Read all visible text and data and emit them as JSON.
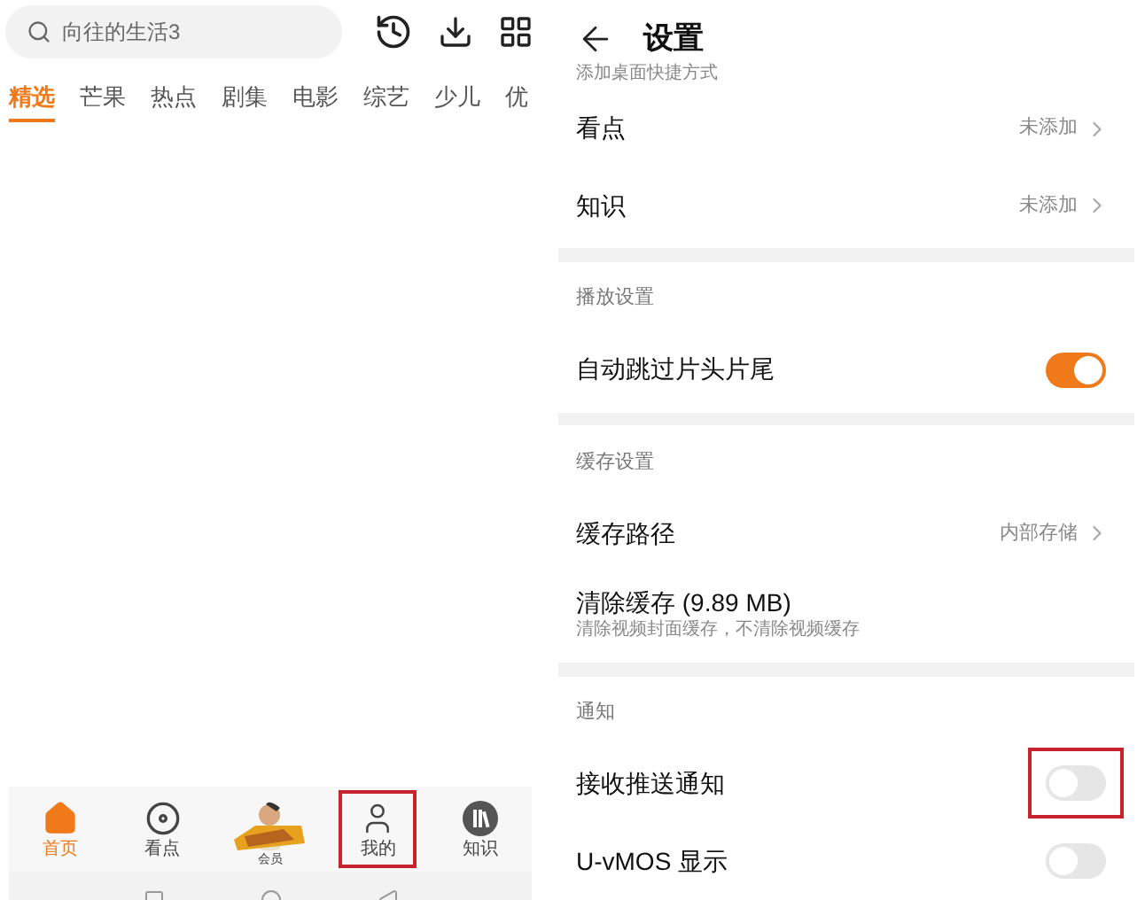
{
  "left": {
    "search": {
      "placeholder": "向往的生活3"
    },
    "categories": [
      {
        "label": "精选",
        "selected": true
      },
      {
        "label": "芒果",
        "selected": false
      },
      {
        "label": "热点",
        "selected": false
      },
      {
        "label": "剧集",
        "selected": false
      },
      {
        "label": "电影",
        "selected": false
      },
      {
        "label": "综艺",
        "selected": false
      },
      {
        "label": "少儿",
        "selected": false
      },
      {
        "label": "优",
        "selected": false
      }
    ],
    "bottom_nav": [
      {
        "kind": "home",
        "label": "首页",
        "selected": true,
        "highlighted": false
      },
      {
        "kind": "target",
        "label": "看点",
        "selected": false,
        "highlighted": false
      },
      {
        "kind": "promo",
        "label": "会员",
        "selected": false,
        "highlighted": false
      },
      {
        "kind": "person",
        "label": "我的",
        "selected": false,
        "highlighted": true
      },
      {
        "kind": "books",
        "label": "知识",
        "selected": false,
        "highlighted": false
      }
    ]
  },
  "right": {
    "title": "设置",
    "cut_text": "添加桌面快捷方式",
    "rows": [
      {
        "kind": "link",
        "label": "看点",
        "value": "未添加"
      },
      {
        "kind": "link",
        "label": "知识",
        "value": "未添加"
      },
      {
        "kind": "band"
      },
      {
        "kind": "header",
        "label": "播放设置"
      },
      {
        "kind": "toggle",
        "label": "自动跳过片头片尾",
        "on": true,
        "highlighted": false
      },
      {
        "kind": "band"
      },
      {
        "kind": "header",
        "label": "缓存设置"
      },
      {
        "kind": "link",
        "label": "缓存路径",
        "value": "内部存储"
      },
      {
        "kind": "action",
        "label": "清除缓存 (9.89 MB)",
        "subtitle": "清除视频封面缓存，不清除视频缓存"
      },
      {
        "kind": "band"
      },
      {
        "kind": "header",
        "label": "通知"
      },
      {
        "kind": "toggle",
        "label": "接收推送通知",
        "on": false,
        "highlighted": true
      },
      {
        "kind": "toggle",
        "label": "U-vMOS 显示",
        "on": false,
        "highlighted": false
      }
    ]
  }
}
